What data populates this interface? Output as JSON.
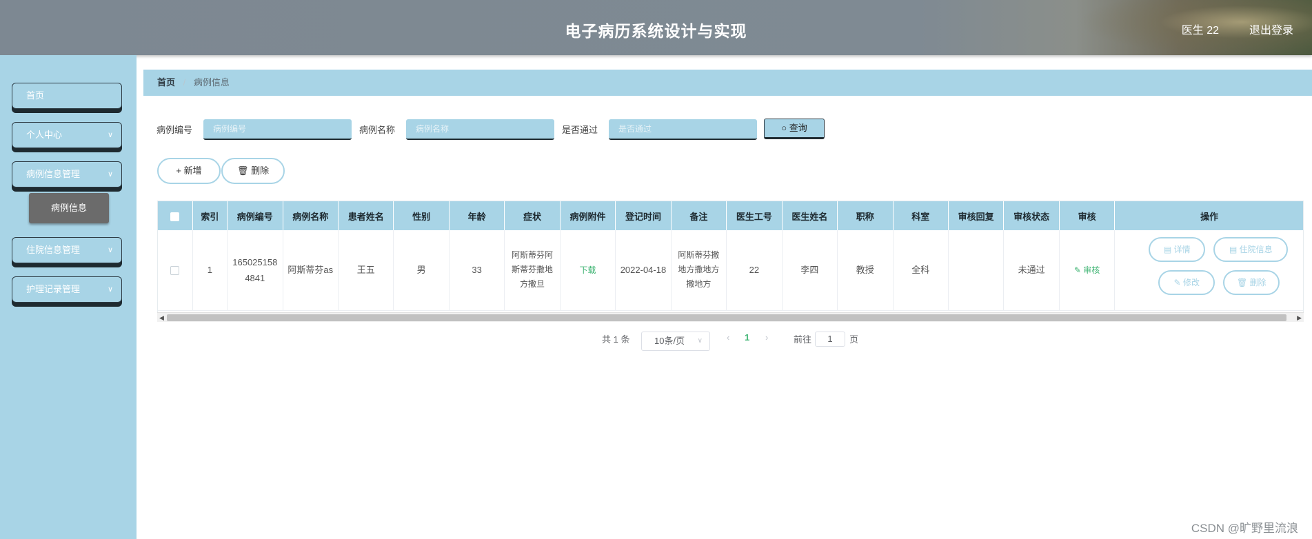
{
  "header": {
    "title": "电子病历系统设计与实现",
    "user": "医生 22",
    "logout": "退出登录"
  },
  "sidebar": {
    "items": [
      {
        "label": "首页",
        "has_children": false
      },
      {
        "label": "个人中心",
        "has_children": true
      },
      {
        "label": "病例信息管理",
        "has_children": true
      },
      {
        "label": "住院信息管理",
        "has_children": true
      },
      {
        "label": "护理记录管理",
        "has_children": true
      }
    ],
    "active_sub": "病例信息",
    "chevron": "∨"
  },
  "breadcrumb": {
    "home": "首页",
    "sep": "/",
    "current": "病例信息"
  },
  "search": {
    "fields": [
      {
        "label": "病例编号",
        "placeholder": "病例编号"
      },
      {
        "label": "病例名称",
        "placeholder": "病例名称"
      },
      {
        "label": "是否通过",
        "placeholder": "是否通过"
      }
    ],
    "button": "查询"
  },
  "actions": {
    "add": "新增",
    "delete": "删除"
  },
  "table": {
    "columns": [
      "",
      "索引",
      "病例编号",
      "病例名称",
      "患者姓名",
      "性别",
      "年龄",
      "症状",
      "病例附件",
      "登记时间",
      "备注",
      "医生工号",
      "医生姓名",
      "职称",
      "科室",
      "审核回复",
      "审核状态",
      "审核",
      "操作"
    ],
    "rows": [
      {
        "index": "1",
        "case_no": "1650251584841",
        "case_name": "阿斯蒂芬as",
        "patient": "王五",
        "gender": "男",
        "age": "33",
        "symptom": "阿斯蒂芬阿斯蒂芬撒地方撒旦",
        "attachment": "下载",
        "reg_time": "2022-04-18",
        "remark": "阿斯蒂芬撒地方撒地方撒地方",
        "doctor_id": "22",
        "doctor_name": "李四",
        "title": "教授",
        "dept": "全科",
        "reply": "",
        "status": "未通过",
        "review": "审核",
        "ops": {
          "detail": "详情",
          "hospital": "住院信息",
          "edit": "修改",
          "delete": "删除"
        }
      }
    ]
  },
  "pagination": {
    "total": "共 1 条",
    "page_size": "10条/页",
    "current": "1",
    "goto": "前往",
    "goto_value": "1",
    "page_unit": "页"
  },
  "watermark": "CSDN @旷野里流浪",
  "colors": {
    "accent": "#a8d4e6",
    "green": "#3cb371",
    "dark": "#1e2a30"
  }
}
